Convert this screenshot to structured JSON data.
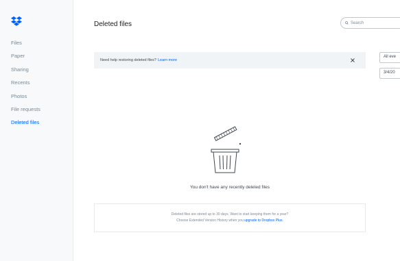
{
  "sidebar": {
    "items": [
      {
        "label": "Files",
        "active": false
      },
      {
        "label": "Paper",
        "active": false
      },
      {
        "label": "Sharing",
        "active": false
      },
      {
        "label": "Recents",
        "active": false
      },
      {
        "label": "Photos",
        "active": false
      },
      {
        "label": "File requests",
        "active": false
      },
      {
        "label": "Deleted files",
        "active": true
      }
    ]
  },
  "header": {
    "title": "Deleted files",
    "search_placeholder": "Search"
  },
  "banner": {
    "text": "Need help restoring deleted files?",
    "link": "Learn more"
  },
  "filters": {
    "select_value": "All eve",
    "date_value": "3/4/20"
  },
  "empty_state": {
    "message": "You don't have any recently deleted files",
    "info_line1": "Deleted files are stored up to 30 days. Want to start keeping them for a year?",
    "info_line2_prefix": "Choose Extended Version History when you",
    "info_link": "upgrade to Dropbox Plus."
  },
  "colors": {
    "accent": "#0061fe",
    "sidebar_bg": "#f7f9fa",
    "banner_bg": "#f0f4f7"
  }
}
